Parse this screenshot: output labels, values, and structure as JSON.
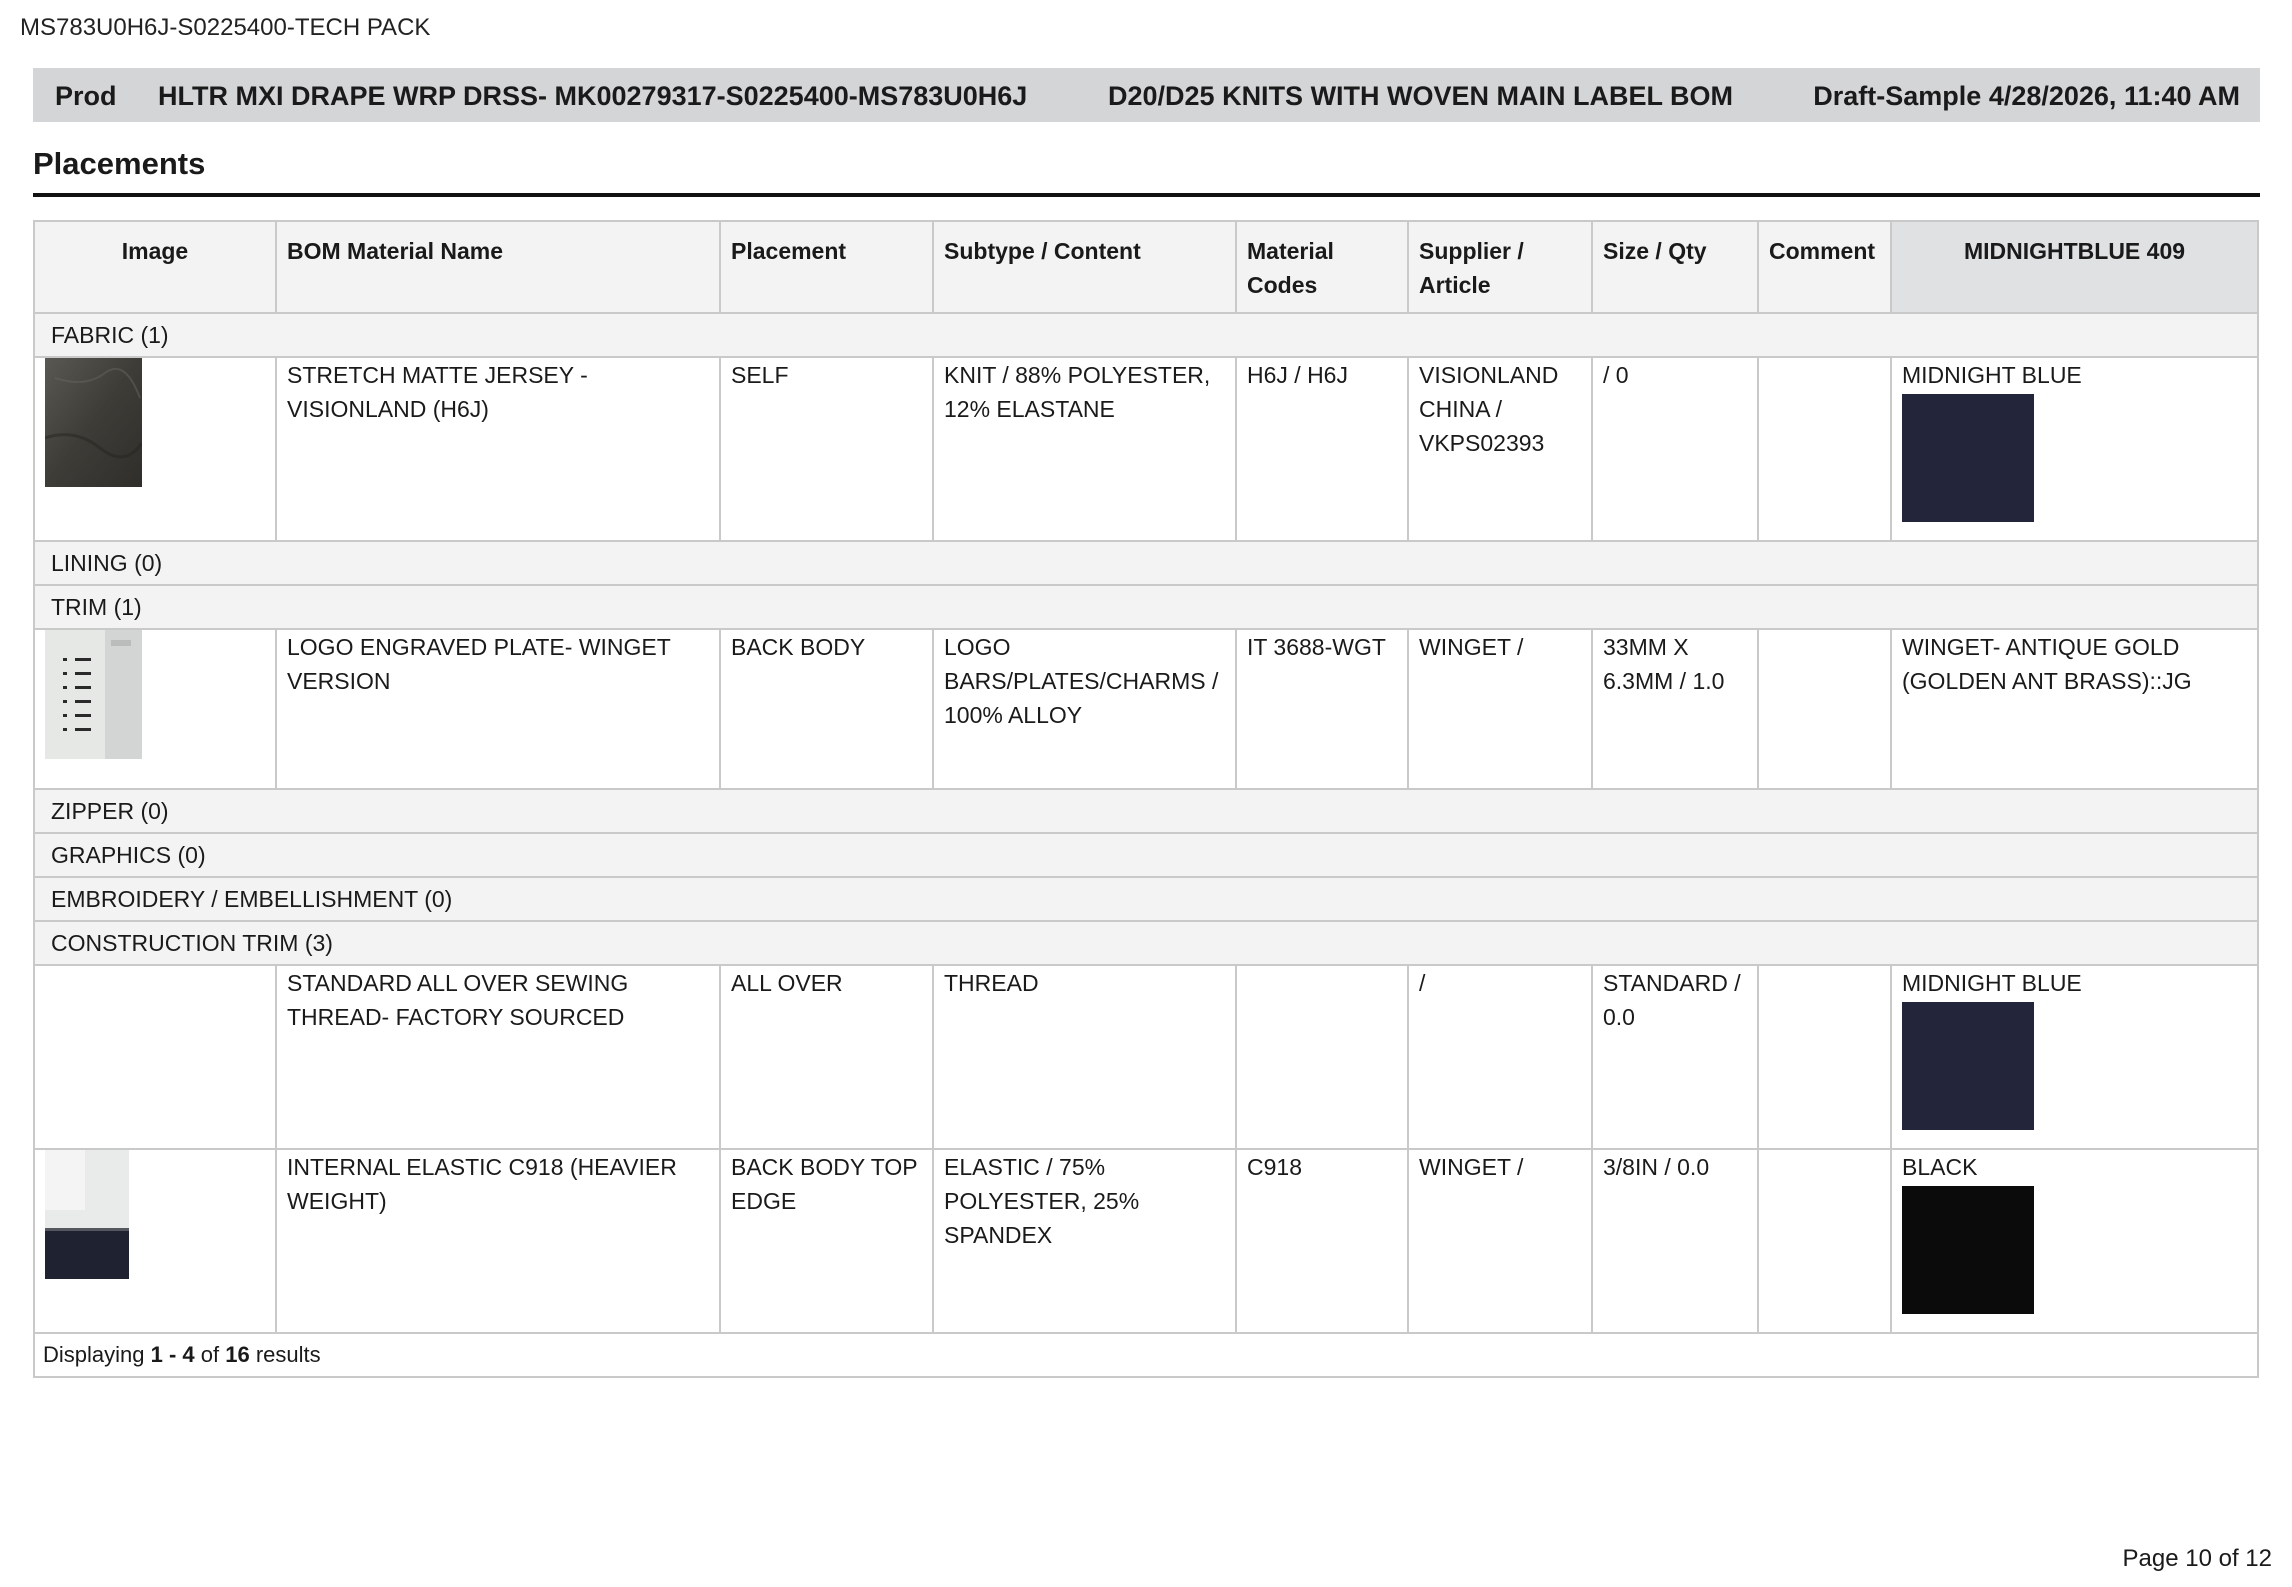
{
  "doc_title": "MS783U0H6J-S0225400-TECH PACK",
  "header": {
    "prod": "Prod",
    "product_name": "HLTR MXI DRAPE WRP DRSS- MK00279317-S0225400-MS783U0H6J",
    "bom": "D20/D25 KNITS WITH WOVEN MAIN LABEL BOM",
    "status": "Draft-Sample 4/28/2026, 11:40 AM"
  },
  "section_title": "Placements",
  "columns": [
    "Image",
    "BOM Material Name",
    "Placement",
    "Subtype / Content",
    "Material Codes",
    "Supplier / Article",
    "Size / Qty",
    "Comment",
    "MIDNIGHTBLUE 409"
  ],
  "categories": {
    "fabric": "FABRIC (1)",
    "lining": "LINING (0)",
    "trim": "TRIM (1)",
    "zipper": "ZIPPER (0)",
    "graphics": "GRAPHICS (0)",
    "embroidery": "EMBROIDERY / EMBELLISHMENT (0)",
    "construction_trim": "CONSTRUCTION TRIM (3)"
  },
  "rows": {
    "fabric_1": {
      "name": "STRETCH MATTE JERSEY - VISIONLAND (H6J)",
      "placement": "SELF",
      "subtype": "KNIT / 88% POLYESTER, 12% ELASTANE",
      "codes": "H6J / H6J",
      "supplier": "VISIONLAND CHINA / VKPS02393",
      "size_qty": "/ 0",
      "comment": "",
      "color_name": "MIDNIGHT BLUE",
      "swatch_color": "#23253a"
    },
    "trim_1": {
      "name": "LOGO ENGRAVED PLATE- WINGET VERSION",
      "placement": "BACK BODY",
      "subtype": "LOGO BARS/PLATES/CHARMS / 100% ALLOY",
      "codes": "IT 3688-WGT",
      "supplier": "WINGET /",
      "size_qty": "33MM X 6.3MM / 1.0",
      "comment": "",
      "color_name": "WINGET- ANTIQUE GOLD (GOLDEN ANT BRASS)::JG"
    },
    "construction_1": {
      "name": "STANDARD ALL OVER SEWING THREAD- FACTORY SOURCED",
      "placement": "ALL OVER",
      "subtype": "THREAD",
      "codes": "",
      "supplier": "/",
      "size_qty": "STANDARD / 0.0",
      "comment": "",
      "color_name": "MIDNIGHT BLUE",
      "swatch_color": "#23253a"
    },
    "construction_2": {
      "name": "INTERNAL ELASTIC C918 (HEAVIER WEIGHT)",
      "placement": "BACK BODY TOP EDGE",
      "subtype": "ELASTIC / 75% POLYESTER, 25% SPANDEX",
      "codes": "C918",
      "supplier": "WINGET /",
      "size_qty": "3/8IN / 0.0",
      "comment": "",
      "color_name": "BLACK",
      "swatch_color": "#0b0b0b"
    }
  },
  "footer": {
    "prefix": "Displaying ",
    "range": "1 - 4",
    "middle": " of ",
    "total": "16",
    "suffix": " results"
  },
  "page_number": "Page 10 of 12"
}
